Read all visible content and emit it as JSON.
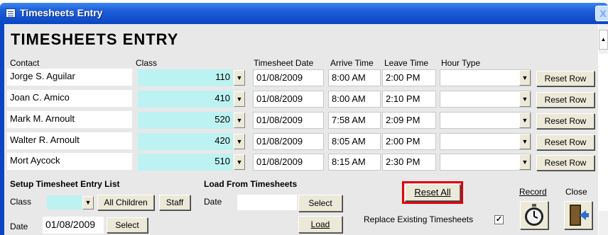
{
  "window": {
    "title": "Timesheets Entry",
    "close_label": "X"
  },
  "page": {
    "title": "TIMESHEETS ENTRY"
  },
  "headers": {
    "contact": "Contact",
    "class": "Class",
    "date": "Timesheet Date",
    "arrive": "Arrive Time",
    "leave": "Leave Time",
    "hour_type": "Hour Type"
  },
  "rows": [
    {
      "contact": "Jorge S. Aguilar",
      "class": "110",
      "date": "01/08/2009",
      "arrive": "8:00 AM",
      "leave": "2:00 PM",
      "hour_type": "",
      "reset": "Reset Row"
    },
    {
      "contact": "Joan C. Amico",
      "class": "410",
      "date": "01/08/2009",
      "arrive": "8:00 AM",
      "leave": "2:10 PM",
      "hour_type": "",
      "reset": "Reset Row"
    },
    {
      "contact": "Mark M. Arnoult",
      "class": "520",
      "date": "01/08/2009",
      "arrive": "7:58 AM",
      "leave": "2:09 PM",
      "hour_type": "",
      "reset": "Reset Row"
    },
    {
      "contact": "Walter R. Arnoult",
      "class": "420",
      "date": "01/08/2009",
      "arrive": "8:05 AM",
      "leave": "2:00 PM",
      "hour_type": "",
      "reset": "Reset Row"
    },
    {
      "contact": "Mort Aycock",
      "class": "510",
      "date": "01/08/2009",
      "arrive": "8:15 AM",
      "leave": "2:30 PM",
      "hour_type": "",
      "reset": "Reset Row"
    }
  ],
  "setup": {
    "heading": "Setup Timesheet Entry List",
    "class_label": "Class",
    "class_value": "",
    "all_children": "All Children",
    "staff": "Staff",
    "date_label": "Date",
    "date_value": "01/08/2009",
    "select": "Select"
  },
  "load": {
    "heading": "Load From Timesheets",
    "date_label": "Date",
    "date_value": "",
    "select": "Select",
    "load": "Load"
  },
  "actions": {
    "reset_all": "Reset All",
    "replace_label": "Replace Existing Timesheets",
    "replace_checked": "✓",
    "record_label": "Record",
    "close_label": "Close",
    "record_icon": "stopwatch-icon",
    "close_icon": "exit-door-icon",
    "reset_all_border": "#e0000c"
  },
  "icons": {
    "dropdown": "▼"
  }
}
